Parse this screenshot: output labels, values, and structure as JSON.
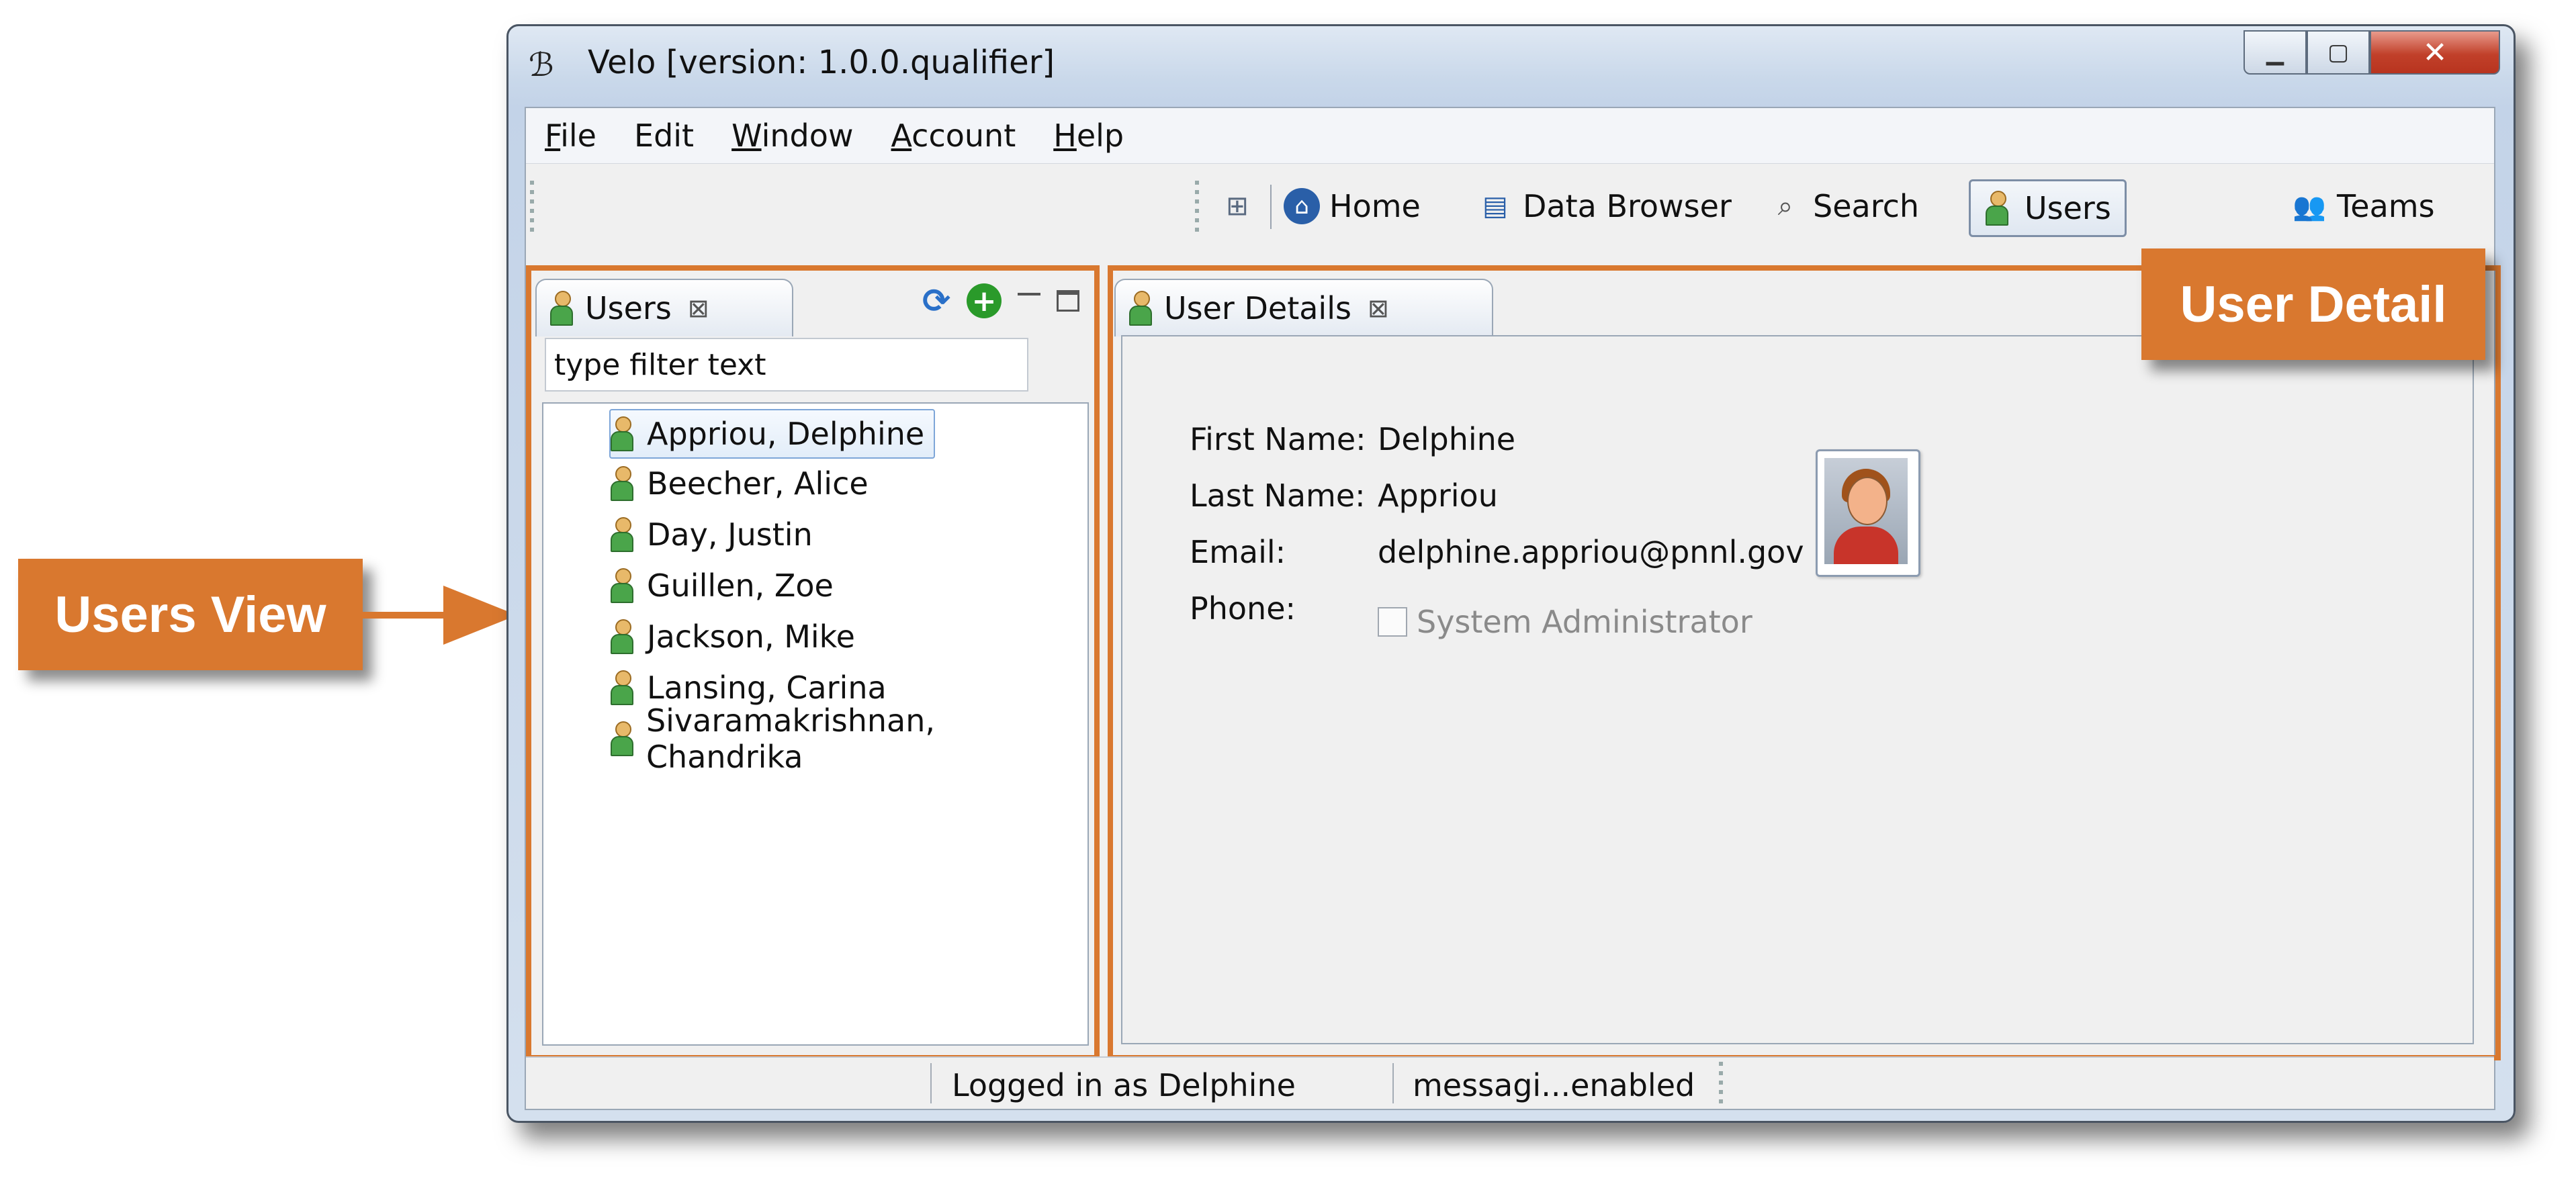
{
  "callouts": {
    "users_view": "Users View",
    "user_detail": "User Detail"
  },
  "window": {
    "title": "Velo [version: 1.0.0.qualifier]",
    "controls": {
      "minimize": "▭",
      "maximize": "⧠",
      "close": "X"
    }
  },
  "menu": {
    "items": [
      {
        "label_ul": "F",
        "label_rest": "ile"
      },
      {
        "label_ul": "",
        "label_rest": "Edit"
      },
      {
        "label_ul": "W",
        "label_rest": "indow"
      },
      {
        "label_ul": "A",
        "label_rest": "ccount"
      },
      {
        "label_ul": "H",
        "label_rest": "elp"
      }
    ]
  },
  "toolbar": {
    "perspectives": [
      {
        "label": "Home",
        "icon": "home-icon"
      },
      {
        "label": "Data Browser",
        "icon": "data-browser-icon"
      },
      {
        "label": "Search",
        "icon": "search-icon"
      },
      {
        "label": "Users",
        "icon": "user-icon",
        "active": true
      },
      {
        "label": "Teams",
        "icon": "teams-icon"
      }
    ]
  },
  "users_view": {
    "tab_label": "Users",
    "filter_placeholder": "type filter text",
    "users": [
      "Appriou, Delphine",
      "Beecher, Alice",
      "Day, Justin",
      "Guillen, Zoe",
      "Jackson, Mike",
      "Lansing, Carina",
      "Sivaramakrishnan, Chandrika"
    ],
    "selected_index": 0
  },
  "user_details": {
    "tab_label": "User Details",
    "fields": {
      "first_name_label": "First Name:",
      "first_name": "Delphine",
      "last_name_label": "Last Name:",
      "last_name": "Appriou",
      "email_label": "Email:",
      "email": "delphine.appriou@pnnl.gov",
      "phone_label": "Phone:",
      "phone": ""
    },
    "system_admin_label": "System Administrator",
    "system_admin_checked": false
  },
  "status_bar": {
    "logged_in": "Logged in as Delphine",
    "messaging": "messagi...enabled"
  },
  "colors": {
    "callout": "#d9782f",
    "selection_border": "#7ea6d8"
  }
}
